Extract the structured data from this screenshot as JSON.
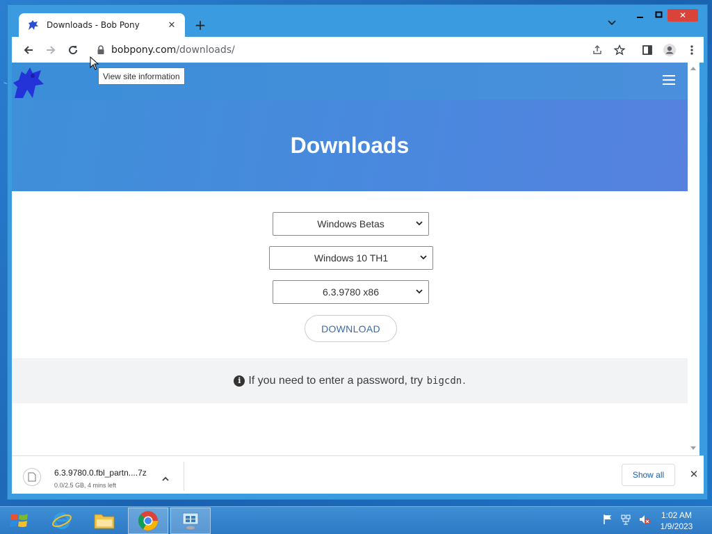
{
  "browser": {
    "tab_title": "Downloads - Bob Pony",
    "url_host": "bobpony.com",
    "url_path": "/downloads/",
    "tooltip": "View site information"
  },
  "page": {
    "hero_title": "Downloads",
    "select_category": "Windows Betas",
    "select_version": "Windows 10 TH1",
    "select_build": "6.3.9780 x86",
    "download_label": "DOWNLOAD",
    "note_prefix": "If you need to enter a password, try",
    "note_code": "bigcdn",
    "note_suffix": "."
  },
  "download_shelf": {
    "filename": "6.3.9780.0.fbl_partn....7z",
    "status": "0.0/2.5 GB, 4 mins left",
    "show_all": "Show all"
  },
  "taskbar": {
    "time": "1:02 AM",
    "date": "1/9/2023"
  },
  "colors": {
    "hero_blue": "#4a8fdb",
    "window_frame": "#3a9be0",
    "close_red": "#d9433a"
  }
}
